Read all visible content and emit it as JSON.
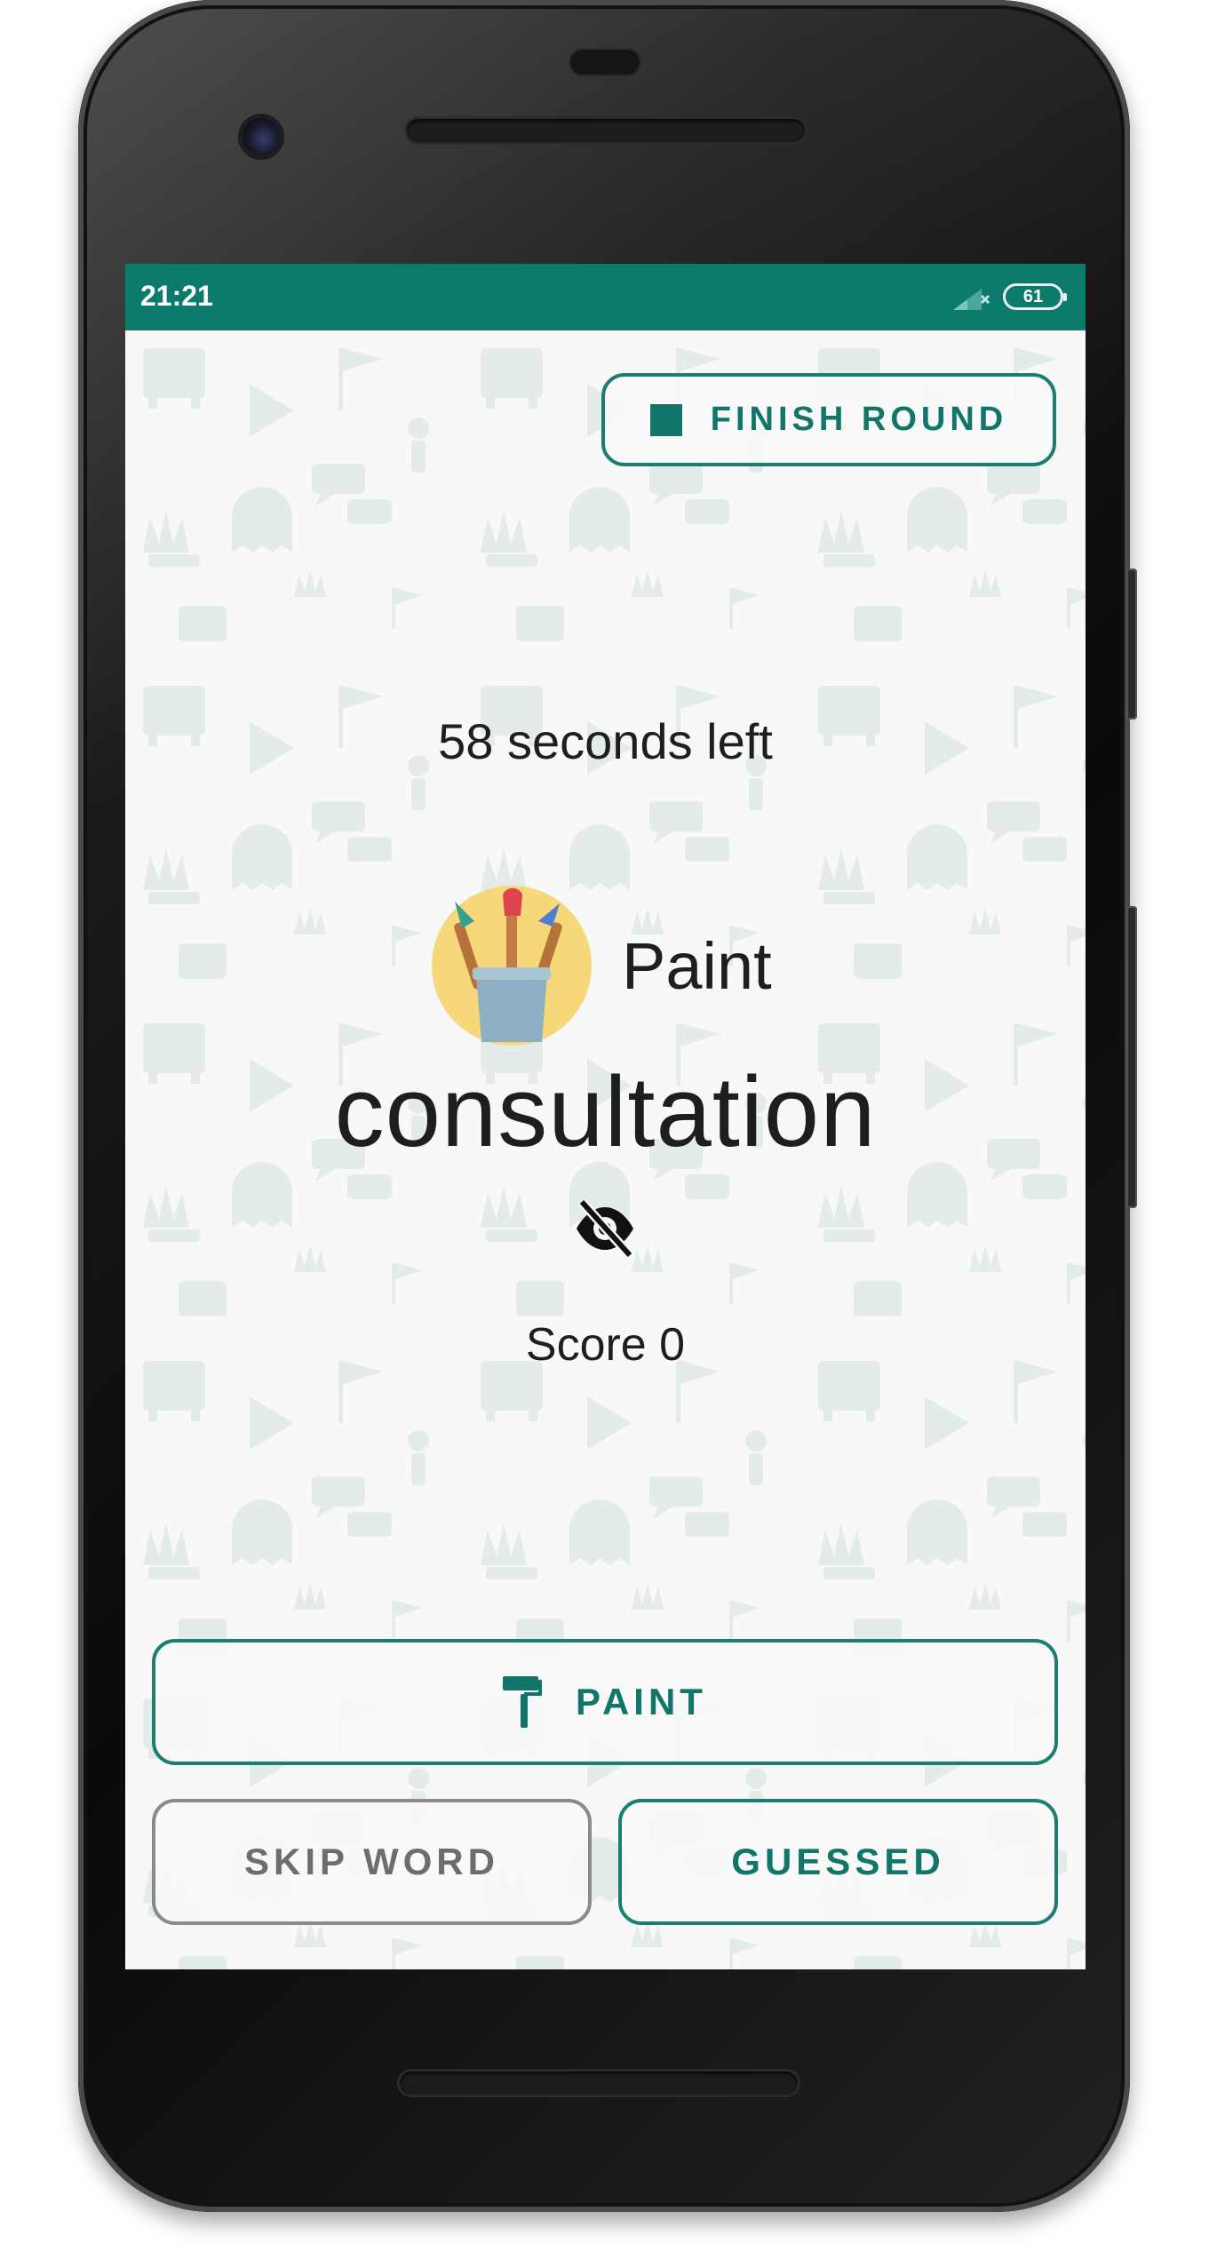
{
  "status_bar": {
    "time": "21:21",
    "battery": "61"
  },
  "toolbar": {
    "finish_round_label": "FINISH ROUND"
  },
  "game": {
    "timer_text": "58 seconds left",
    "category_label": "Paint",
    "category_icon": "paint-brushes-cup-icon",
    "word": "consultation",
    "hide_word_icon": "eye-off-icon",
    "score_text": "Score 0"
  },
  "actions": {
    "mode_label": "PAINT",
    "mode_icon": "paint-roller-icon",
    "skip_label": "SKIP WORD",
    "guessed_label": "GUESSED"
  },
  "colors": {
    "accent": "#12756a",
    "status_bar": "#0c7b6e",
    "background": "#f7f8f7",
    "skip_border": "#8a8a8a"
  }
}
